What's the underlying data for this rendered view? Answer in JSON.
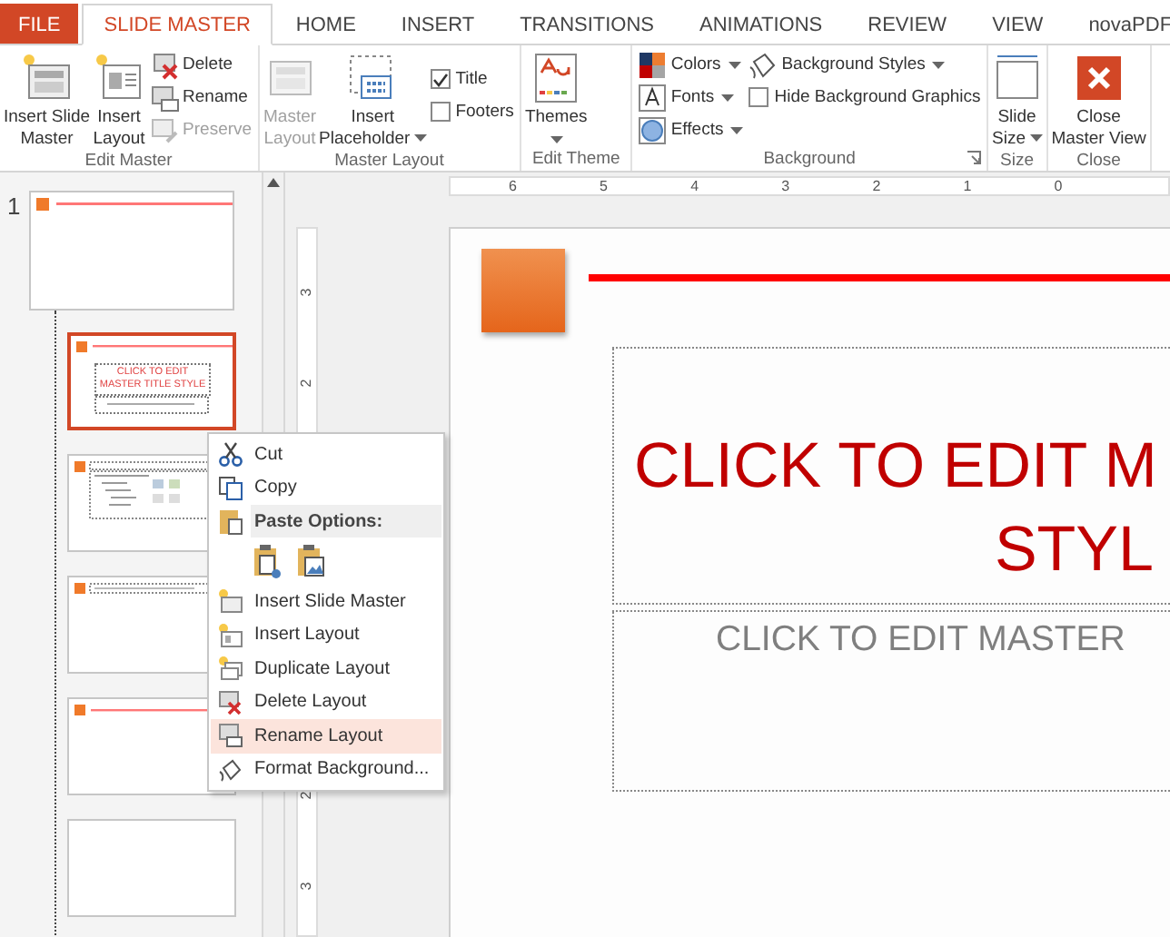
{
  "tabs": [
    {
      "label": "FILE",
      "kind": "file",
      "selected": false
    },
    {
      "label": "SLIDE MASTER",
      "kind": "tab",
      "selected": true
    },
    {
      "label": "HOME",
      "kind": "tab",
      "selected": false
    },
    {
      "label": "INSERT",
      "kind": "tab",
      "selected": false
    },
    {
      "label": "TRANSITIONS",
      "kind": "tab",
      "selected": false
    },
    {
      "label": "ANIMATIONS",
      "kind": "tab",
      "selected": false
    },
    {
      "label": "REVIEW",
      "kind": "tab",
      "selected": false
    },
    {
      "label": "VIEW",
      "kind": "tab",
      "selected": false
    },
    {
      "label": "novaPDF",
      "kind": "tab",
      "selected": false
    }
  ],
  "ribbon": {
    "groups": [
      {
        "label": "Edit Master",
        "launcher": false,
        "items": [
          {
            "kind": "large",
            "label": "Insert Slide\nMaster",
            "disabled": false,
            "dropdown": false
          },
          {
            "kind": "large",
            "label": "Insert\nLayout",
            "disabled": false,
            "dropdown": false
          },
          {
            "kind": "small",
            "label": "Delete",
            "disabled": false,
            "dropdown": false
          },
          {
            "kind": "small",
            "label": "Rename",
            "disabled": false,
            "dropdown": false
          },
          {
            "kind": "small",
            "label": "Preserve",
            "disabled": true,
            "dropdown": false
          }
        ]
      },
      {
        "label": "Master Layout",
        "launcher": false,
        "items": [
          {
            "kind": "large",
            "label": "Master\nLayout",
            "disabled": true,
            "dropdown": false
          },
          {
            "kind": "large",
            "label": "Insert\nPlaceholder",
            "disabled": false,
            "dropdown": true
          },
          {
            "kind": "check",
            "label": "Title",
            "checked": true
          },
          {
            "kind": "check",
            "label": "Footers",
            "checked": false
          }
        ]
      },
      {
        "label": "Edit Theme",
        "launcher": false,
        "items": [
          {
            "kind": "large",
            "label": "Themes",
            "disabled": false,
            "dropdown": true
          }
        ]
      },
      {
        "label": "Background",
        "launcher": true,
        "items": [
          {
            "kind": "small",
            "label": "Colors",
            "disabled": false,
            "dropdown": true
          },
          {
            "kind": "small",
            "label": "Fonts",
            "disabled": false,
            "dropdown": true
          },
          {
            "kind": "small",
            "label": "Effects",
            "disabled": false,
            "dropdown": true
          },
          {
            "kind": "small",
            "label": "Background Styles",
            "disabled": false,
            "dropdown": true
          },
          {
            "kind": "check",
            "label": "Hide Background Graphics",
            "checked": false
          }
        ]
      },
      {
        "label": "Size",
        "launcher": false,
        "items": [
          {
            "kind": "large",
            "label": "Slide\nSize",
            "disabled": false,
            "dropdown": true
          }
        ]
      },
      {
        "label": "Close",
        "launcher": false,
        "items": [
          {
            "kind": "large",
            "label": "Close\nMaster View",
            "disabled": false,
            "dropdown": false
          }
        ]
      }
    ]
  },
  "thumbnails": [
    {
      "number": "1",
      "kind": "master",
      "selected": false
    },
    {
      "kind": "title",
      "title": "CLICK TO EDIT MASTER TITLE STYLE",
      "selected": true
    },
    {
      "kind": "content",
      "selected": false
    },
    {
      "kind": "header",
      "selected": false
    },
    {
      "kind": "accent",
      "selected": false
    },
    {
      "kind": "blank",
      "selected": false
    }
  ],
  "rulers": {
    "horizontal": [
      "6",
      "5",
      "4",
      "3",
      "2",
      "1",
      "0"
    ],
    "vertical": [
      "3",
      "2",
      "2",
      "3"
    ]
  },
  "slide": {
    "title_lines": [
      "CLICK TO EDIT M",
      "STYL"
    ],
    "subtitle": "CLICK TO EDIT MASTER"
  },
  "context_menu": {
    "items": [
      {
        "kind": "command",
        "label": "Cut",
        "selected": false
      },
      {
        "kind": "command",
        "label": "Copy",
        "selected": false
      },
      {
        "kind": "header",
        "label": "Paste Options:"
      },
      {
        "kind": "paste"
      },
      {
        "kind": "command",
        "label": "Insert Slide Master",
        "selected": false
      },
      {
        "kind": "command",
        "label": "Insert Layout",
        "selected": false
      },
      {
        "kind": "command",
        "label": "Duplicate Layout",
        "selected": false
      },
      {
        "kind": "command",
        "label": "Delete Layout",
        "selected": false
      },
      {
        "kind": "command",
        "label": "Rename Layout",
        "selected": true
      },
      {
        "kind": "command",
        "label": "Format Background...",
        "selected": false
      }
    ]
  }
}
